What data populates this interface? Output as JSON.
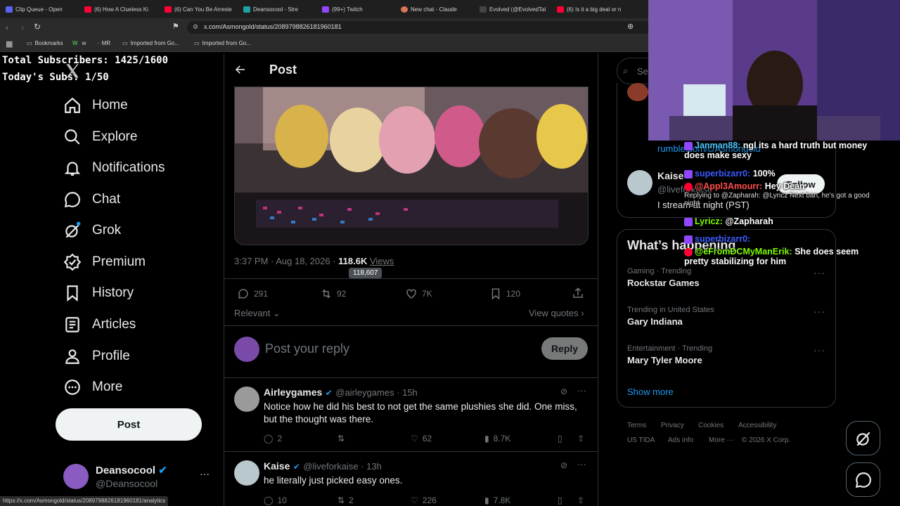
{
  "browser": {
    "tabs": [
      {
        "label": "Clip Queue - Open",
        "color": "#5865f2"
      },
      {
        "label": "(6) How A Clueless Ki",
        "color": "#ff0033"
      },
      {
        "label": "(6) Can You Be Arreste",
        "color": "#ff0033"
      },
      {
        "label": "Deansocool - Stre",
        "color": "#1da1a1"
      },
      {
        "label": "(99+) Twitch",
        "color": "#9146ff"
      },
      {
        "label": "New chat - Claude",
        "color": "#d97757"
      },
      {
        "label": "Evolved (@EvolvedTal",
        "color": "#444444"
      },
      {
        "label": "(6) Is it a big deal or n",
        "color": "#ff0033"
      }
    ],
    "url": "x.com/Asmongold/status/2089798826181960181",
    "bookmarks": [
      "Bookmarks",
      "w",
      "MR",
      "Imported from Go...",
      "Imported from Go..."
    ],
    "status_url": "https://x.com/Asmongold/status/2089798826181960181/analytics"
  },
  "overlay": {
    "subs_total": "Total Subscribers: 1425/1600",
    "subs_today": "Today's Subs: 1/50"
  },
  "sidebar": {
    "items": [
      {
        "label": "Home",
        "icon": "home-icon"
      },
      {
        "label": "Explore",
        "icon": "search-icon"
      },
      {
        "label": "Notifications",
        "icon": "bell-icon"
      },
      {
        "label": "Chat",
        "icon": "chat-bubble-icon"
      },
      {
        "label": "Grok",
        "icon": "grok-icon"
      },
      {
        "label": "Premium",
        "icon": "verified-icon"
      },
      {
        "label": "History",
        "icon": "bookmark-icon"
      },
      {
        "label": "Articles",
        "icon": "article-icon"
      },
      {
        "label": "Profile",
        "icon": "person-icon"
      },
      {
        "label": "More",
        "icon": "more-circle-icon"
      }
    ],
    "post_button": "Post",
    "account": {
      "name": "Deansocool",
      "handle": "@Deansocool"
    }
  },
  "post": {
    "header_title": "Post",
    "timestamp": "3:37 PM · Aug 18, 2026 · ",
    "views": "118.6K",
    "views_label": "Views",
    "views_tooltip": "118,607",
    "replies": "291",
    "reposts": "92",
    "likes": "7K",
    "bookmarks": "120",
    "sort_label": "Relevant",
    "view_quotes": "View quotes",
    "reply_placeholder": "Post your reply",
    "reply_button": "Reply"
  },
  "replies": [
    {
      "name": "Airleygames",
      "handle": "@airleygames · 15h",
      "text": "Notice how he did his best to not get the same plushies she did. One miss, but the thought was there.",
      "replies": "2",
      "reposts": "",
      "likes": "62",
      "views": "8.7K"
    },
    {
      "name": "Kaise",
      "handle": "@liveforkaise · 13h",
      "text": "he literally just picked easy ones.",
      "replies": "10",
      "reposts": "2",
      "likes": "226",
      "views": "7.8K"
    }
  ],
  "right": {
    "search_placeholder": "Se",
    "profile_link": "rumble.com/c/Asmongold",
    "profile_name": "Kaise",
    "profile_handle": "@liveforkaise",
    "profile_bio": "I stream at night (PST)",
    "follow_button": "Follow",
    "happening_title": "What’s happening",
    "trends": [
      {
        "category": "Gaming · Trending",
        "title": "Rockstar Games"
      },
      {
        "category": "Trending in United States",
        "title": "Gary Indiana"
      },
      {
        "category": "Entertainment · Trending",
        "title": "Mary Tyler Moore"
      }
    ],
    "show_more": "Show more",
    "footer": [
      "Terms",
      "Privacy",
      "Cookies",
      "Accessibility",
      "US TIDA",
      "Ads info",
      "More ···",
      "© 2026 X Corp."
    ]
  },
  "stream_chat": [
    {
      "user": "Janman88:",
      "text": "ngl its a hard truth but money does make sexy",
      "color": "#4fc3f7"
    },
    {
      "user": "superbizarr0:",
      "text": "100%",
      "color": "#3b5bff"
    },
    {
      "user": "@Appl3Amourr:",
      "text": "Hey Dean",
      "color": "#ff4d4d"
    },
    {
      "user": "",
      "text": "Replying to @Zapharah: @Lyricz Next ban, he's got a good night",
      "color": "#cccccc"
    },
    {
      "user": "Lyricz:",
      "text": "@Zapharah",
      "color": "#7cfc00"
    },
    {
      "user": "superbizarr0:",
      "text": "",
      "color": "#3b5bff"
    },
    {
      "user": "@eFromDCMyManErik:",
      "text": "She does seem pretty stabilizing for him",
      "color": "#7cfc00"
    }
  ],
  "colors": {
    "accent": "#1d9bf0",
    "bg": "#000000",
    "border": "#2f3336",
    "muted": "#71767b"
  }
}
